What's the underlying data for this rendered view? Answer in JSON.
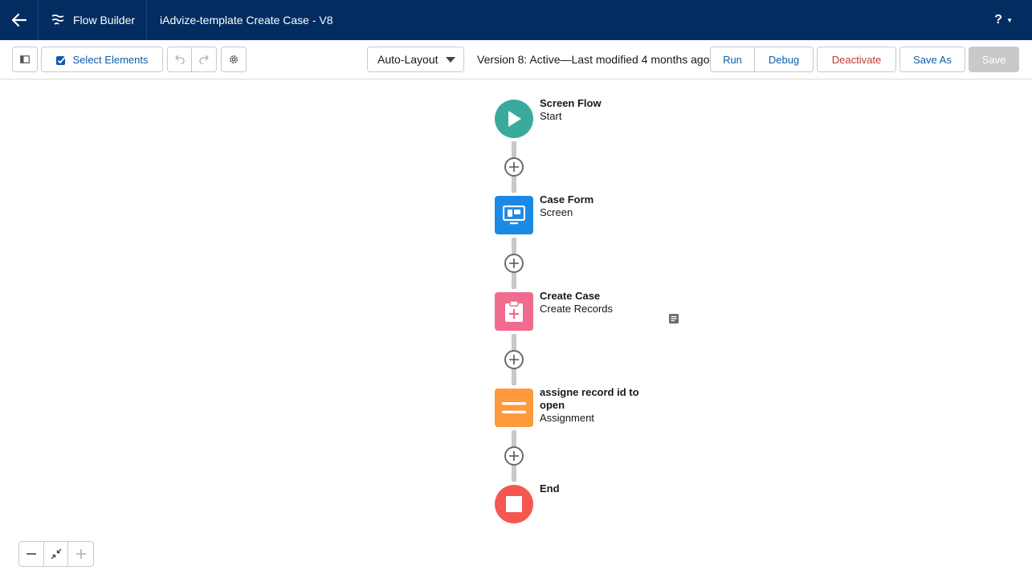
{
  "header": {
    "app_name": "Flow Builder",
    "flow_title": "iAdvize-template Create Case - V8",
    "help_label": "?"
  },
  "toolbar": {
    "select_elements_label": "Select Elements",
    "layout_value": "Auto-Layout",
    "version_status": "Version 8: Active—Last modified 4 months ago",
    "run_label": "Run",
    "debug_label": "Debug",
    "deactivate_label": "Deactivate",
    "save_as_label": "Save As",
    "save_label": "Save"
  },
  "flow": {
    "nodes": [
      {
        "title": "Screen Flow",
        "subtitle": "Start",
        "icon": "play-icon",
        "color": "#3ba99c"
      },
      {
        "title": "Case Form",
        "subtitle": "Screen",
        "icon": "screen-icon",
        "color": "#1b8ae4"
      },
      {
        "title": "Create Case",
        "subtitle": "Create Records",
        "icon": "record-create-icon",
        "color": "#f06b8e"
      },
      {
        "title": "assigne record id to open",
        "subtitle": "Assignment",
        "icon": "assignment-icon",
        "color": "#ff9a3c"
      },
      {
        "title": "End",
        "subtitle": "",
        "icon": "stop-icon",
        "color": "#f4574f"
      }
    ]
  },
  "colors": {
    "header_bg": "#032d60",
    "brand_blue": "#0b5cab",
    "destructive": "#c23934",
    "disabled": "#c9c9c9"
  }
}
